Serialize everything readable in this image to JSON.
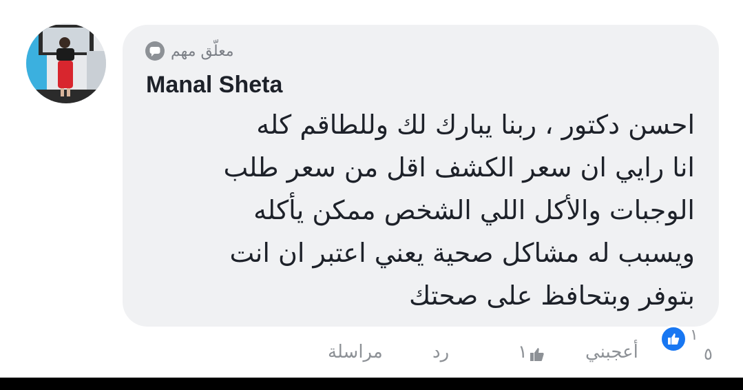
{
  "comment": {
    "badge_label": "معلّق مهم",
    "author": "Manal Sheta",
    "text_lines": [
      "احسن دكتور ، ربنا يبارك لك وللطاقم كله",
      "انا رايي ان سعر الكشف اقل من سعر طلب",
      "الوجبات والأكل اللي الشخص ممكن يأكله",
      "ويسبب له مشاكل صحية  يعني اعتبر ان انت",
      "بتوفر وبتحافظ على صحتك"
    ]
  },
  "actions": {
    "like_label": "أعجبني",
    "like_count": "١",
    "reply_label": "رد",
    "message_label": "مراسلة",
    "reactions_count": "١",
    "page_number": "٥"
  },
  "icons": {
    "badge": "chat-bubble-icon",
    "like": "thumbs-up-icon",
    "reaction": "like-reaction-icon"
  },
  "colors": {
    "bubble": "#f0f1f3",
    "text": "#1d2129",
    "muted": "#8d9196",
    "like_blue": "#1877f2"
  }
}
